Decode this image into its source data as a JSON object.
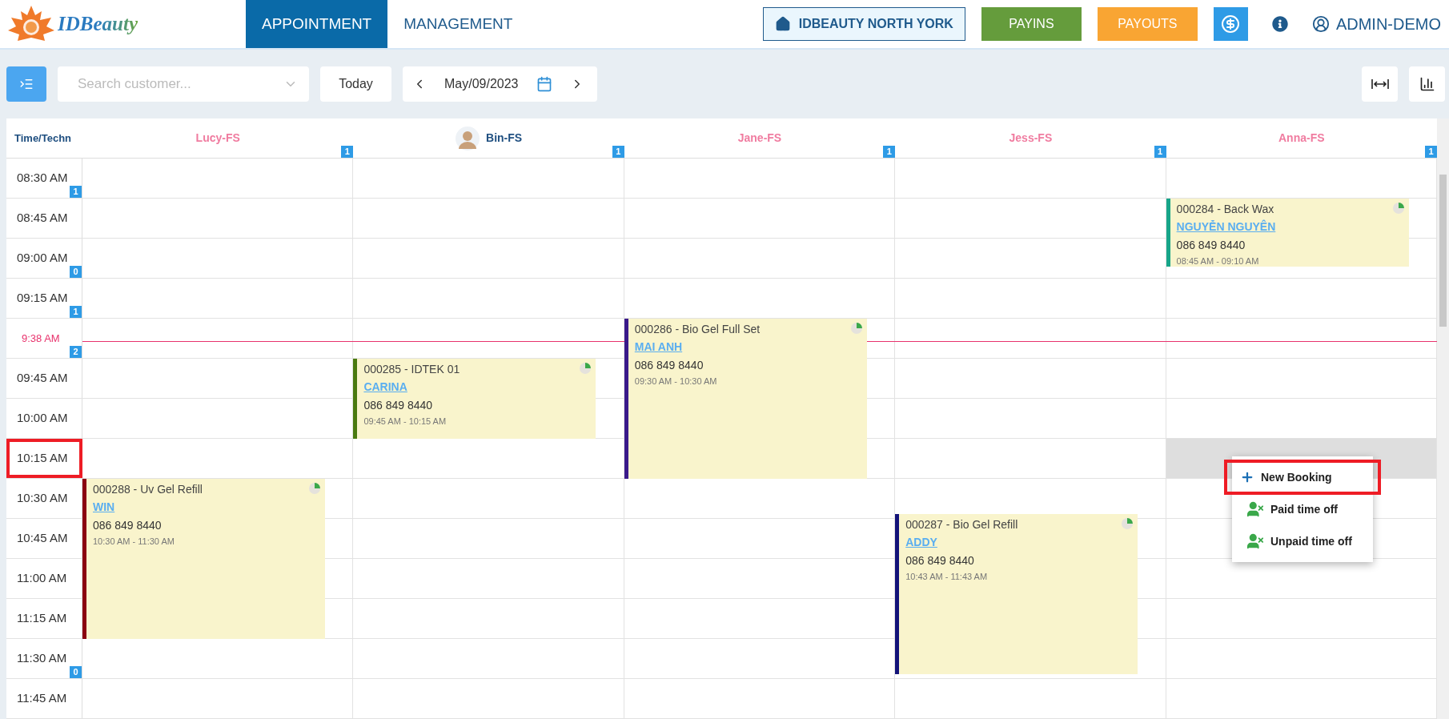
{
  "logo": {
    "text": "IDBeauty"
  },
  "nav": {
    "tabs": [
      {
        "label": "APPOINTMENT",
        "selected": true
      },
      {
        "label": "MANAGEMENT",
        "selected": false
      }
    ],
    "location": "IDBEAUTY NORTH YORK",
    "payins": "PAYINS",
    "payouts": "PAYOUTS",
    "user": "ADMIN-DEMO"
  },
  "toolbar": {
    "search": {
      "placeholder": "Search customer..."
    },
    "today": "Today",
    "date": "May/09/2023"
  },
  "calendar": {
    "time_header": "Time/Techn",
    "technicians": [
      {
        "name": "Lucy-FS",
        "count": "1",
        "avatar": false
      },
      {
        "name": "Bin-FS",
        "count": "1",
        "avatar": true
      },
      {
        "name": "Jane-FS",
        "count": "1",
        "avatar": false
      },
      {
        "name": "Jess-FS",
        "count": "1",
        "avatar": false
      },
      {
        "name": "Anna-FS",
        "count": "1",
        "avatar": false
      }
    ],
    "slots": [
      {
        "time": "08:30 AM",
        "count": "1",
        "kind": "slot",
        "selected": false
      },
      {
        "time": "08:45 AM",
        "kind": "slot",
        "selected": false
      },
      {
        "time": "09:00 AM",
        "count": "0",
        "kind": "slot",
        "selected": false
      },
      {
        "time": "09:15 AM",
        "count": "1",
        "kind": "slot",
        "selected": false
      },
      {
        "time": "9:38 AM",
        "count": "2",
        "kind": "now",
        "selected": false
      },
      {
        "time": "09:45 AM",
        "kind": "slot",
        "selected": false
      },
      {
        "time": "10:00 AM",
        "kind": "slot",
        "selected": false
      },
      {
        "time": "10:15 AM",
        "kind": "slot",
        "selected": true
      },
      {
        "time": "10:30 AM",
        "kind": "slot",
        "selected": false
      },
      {
        "time": "10:45 AM",
        "kind": "slot",
        "selected": false
      },
      {
        "time": "11:00 AM",
        "kind": "slot",
        "selected": false
      },
      {
        "time": "11:15 AM",
        "kind": "slot",
        "selected": false
      },
      {
        "time": "11:30 AM",
        "count": "0",
        "kind": "slot",
        "selected": false
      },
      {
        "time": "11:45 AM",
        "kind": "slot",
        "selected": false
      }
    ],
    "appointments": [
      {
        "title": "000284 - Back Wax",
        "customer": "NGUYỄN NGUYÊN",
        "phone": "086 849 8440",
        "time": "08:45 AM - 09:10 AM",
        "color": "#17a589"
      },
      {
        "title": "000286 - Bio Gel Full Set",
        "customer": "MAI ANH",
        "phone": "086 849 8440",
        "time": "09:30 AM - 10:30 AM",
        "color": "#3a1a8a"
      },
      {
        "title": "000285 - IDTEK 01",
        "customer": "CARINA",
        "phone": "086 849 8440",
        "time": "09:45 AM - 10:15 AM",
        "color": "#4a7a10"
      },
      {
        "title": "000288 - Uv Gel Refill",
        "customer": "WIN",
        "phone": "086 849 8440",
        "time": "10:30 AM - 11:30 AM",
        "color": "#8b0010"
      },
      {
        "title": "000287 - Bio Gel Refill",
        "customer": "ADDY",
        "phone": "086 849 8440",
        "time": "10:43 AM - 11:43 AM",
        "color": "#14147a"
      }
    ],
    "context_menu": {
      "items": [
        {
          "label": "New Booking",
          "kind": "add",
          "selected": true
        },
        {
          "label": "Paid time off",
          "kind": "timeoff",
          "selected": false
        },
        {
          "label": "Unpaid time off",
          "kind": "timeoff",
          "selected": false
        }
      ]
    }
  }
}
